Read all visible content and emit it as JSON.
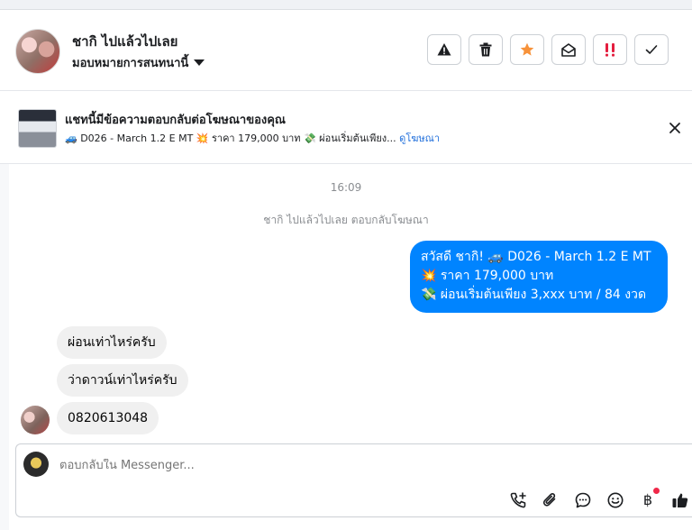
{
  "header": {
    "contact_name": "ชากิ ไปแล้วไปเลย",
    "assign_label": "มอบหมายการสนทนานี้",
    "actions": [
      {
        "icon": "warning-icon"
      },
      {
        "icon": "trash-icon"
      },
      {
        "icon": "star-icon",
        "color": "#f7923a"
      },
      {
        "icon": "envelope-open-icon"
      },
      {
        "icon": "priority-icon",
        "color": "#e41e3f"
      },
      {
        "icon": "check-icon"
      }
    ]
  },
  "ad": {
    "title": "แชทนี้มีข้อความตอบกลับต่อโฆษณาของคุณ",
    "subtitle": "🚙 D026 - March 1.2 E MT 💥 ราคา 179,000 บาท 💸 ผ่อนเริ่มต้นเพียง...",
    "link": "ดูโฆษณา"
  },
  "conversation": {
    "timestamp": "16:09",
    "system_note": "ชากิ ไปแล้วไปเลย ตอบกลับโฆษณา",
    "outgoing": {
      "lines": [
        "สวัสดี ชากิ! 🚙 D026 - March 1.2 E MT",
        "💥 ราคา 179,000 บาท",
        "💸 ผ่อนเริ่มต้นเพียง 3,xxx บาท / 84 งวด"
      ],
      "color": "#0084ff"
    },
    "incoming": [
      "ผ่อนเท่าไหร่ครับ",
      "ว่าดาวน์เท่าไหร่ครับ",
      "0820613048"
    ]
  },
  "composer": {
    "placeholder": "ตอบกลับใน Messenger...",
    "tools": [
      {
        "icon": "phone-add-icon"
      },
      {
        "icon": "paperclip-icon"
      },
      {
        "icon": "saved-reply-icon"
      },
      {
        "icon": "emoji-icon"
      },
      {
        "icon": "baht-icon",
        "glyph": "฿",
        "badge": true
      },
      {
        "icon": "thumbs-up-icon"
      }
    ]
  }
}
